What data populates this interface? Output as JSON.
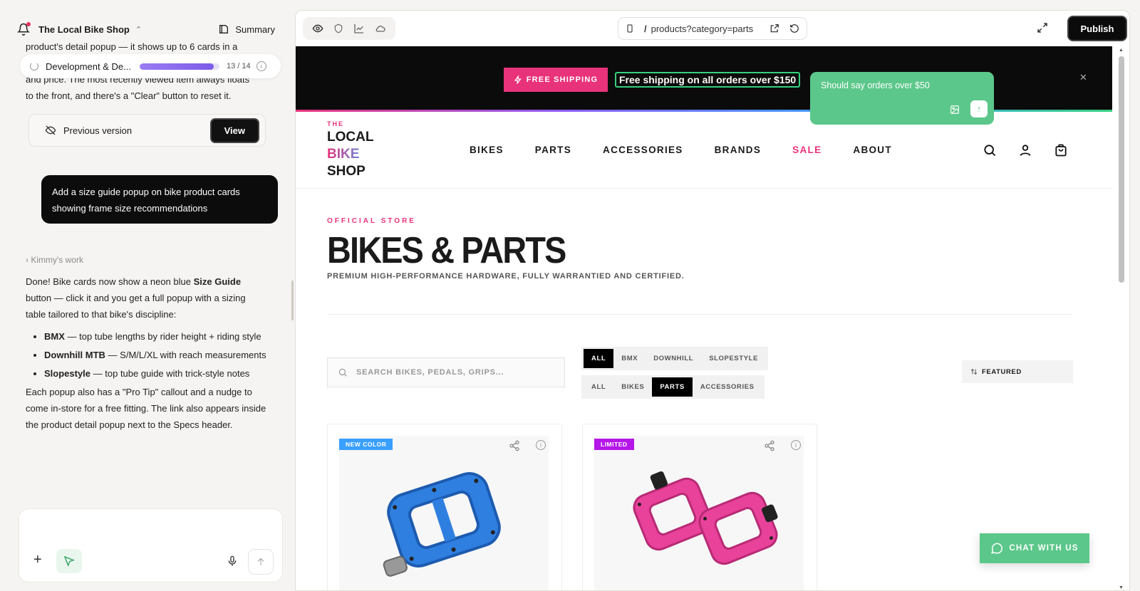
{
  "left_panel": {
    "project_name": "The Local Bike Shop",
    "summary_label": "Summary",
    "cut_text_1": "product's detail popup — it shows up to 6 cards in a",
    "cut_text_2": "and price. The most recently viewed item always floats",
    "cut_text_3": "to the front, and there's a \"Clear\" button to reset it.",
    "progress": {
      "label": "Development & De...",
      "count": "13 / 14",
      "fraction": 0.93
    },
    "previous_version_label": "Previous version",
    "view_label": "View",
    "user_message": "Add a size guide popup on bike product cards showing frame size recommendations",
    "work_label": "Kimmy's work",
    "reply": {
      "intro_pre": "Done! Bike cards now show a neon blue ",
      "intro_bold": "Size Guide",
      "intro_post": " button — click it and you get a full popup with a sizing table tailored to that bike's discipline:",
      "bullets": [
        {
          "bold": "BMX",
          "text": " — top tube lengths by rider height + riding style"
        },
        {
          "bold": "Downhill MTB",
          "text": " — S/M/L/XL with reach measurements"
        },
        {
          "bold": "Slopestyle",
          "text": " — top tube guide with trick-style notes"
        }
      ],
      "outro": "Each popup also has a \"Pro Tip\" callout and a nudge to come in-store for a free fitting. The link also appears inside the product detail popup next to the Specs header."
    }
  },
  "topbar": {
    "url": "products?category=parts",
    "publish_label": "Publish"
  },
  "site": {
    "banner_badge": "FREE SHIPPING",
    "banner_text": "Free shipping on all orders over $150",
    "comment_text": "Should say orders over $50",
    "logo": {
      "the": "THE",
      "line1": "LOCAL",
      "line2": "BIKE",
      "line3": "SHOP"
    },
    "nav": [
      "BIKES",
      "PARTS",
      "ACCESSORIES",
      "BRANDS",
      "SALE",
      "ABOUT"
    ],
    "eyebrow": "OFFICIAL STORE",
    "title": "BIKES & PARTS",
    "subtitle": "PREMIUM HIGH-PERFORMANCE HARDWARE, FULLY WARRANTIED AND CERTIFIED.",
    "search_placeholder": "SEARCH BIKES, PEDALS, GRIPS...",
    "filter_row1": [
      "ALL",
      "BMX",
      "DOWNHILL",
      "SLOPESTYLE"
    ],
    "filter_row2": [
      "ALL",
      "BIKES",
      "PARTS",
      "ACCESSORIES"
    ],
    "sort_label": "FEATURED",
    "cards": [
      {
        "tag": "NEW COLOR",
        "tag_color": "#3aa0ff",
        "product_color": "#2f7fe0"
      },
      {
        "tag": "LIMITED",
        "tag_color": "#b517e8",
        "product_color": "#e8429a"
      }
    ],
    "chat_label": "CHAT WITH US",
    "accent": "#e8337b",
    "green": "#5cc78a"
  }
}
